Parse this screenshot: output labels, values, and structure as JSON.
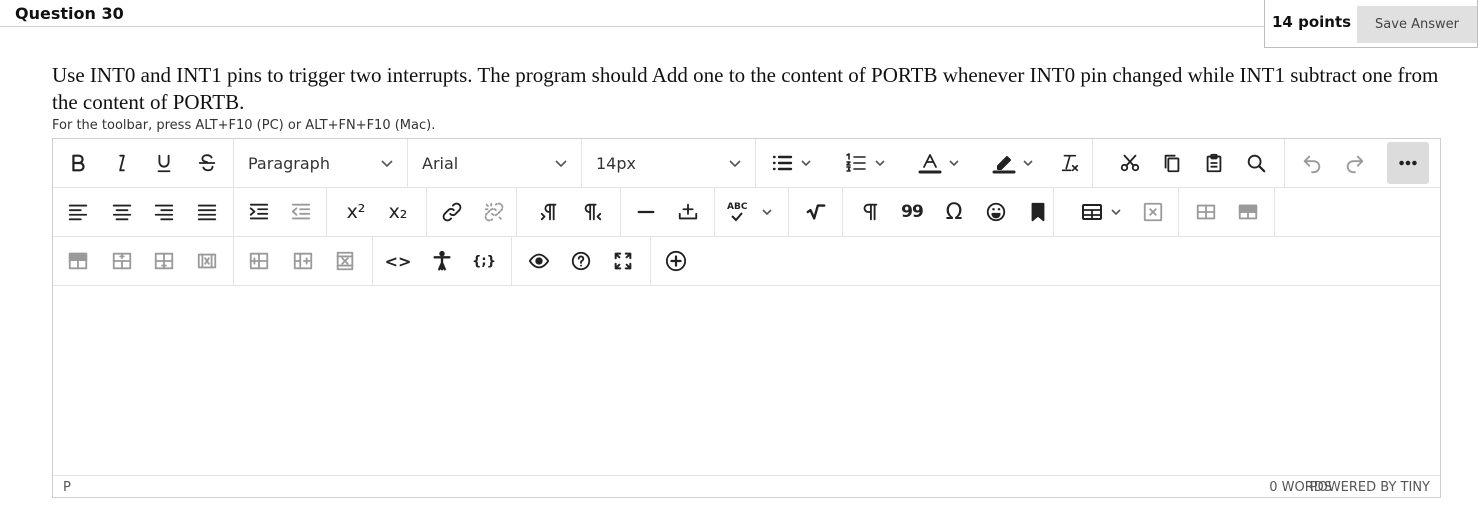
{
  "question": {
    "title": "Question 30",
    "points": "14 points",
    "save_label": "Save Answer",
    "prompt": "Use INT0 and INT1 pins to trigger two interrupts. The program should Add one to the content of PORTB whenever INT0 pin changed while INT1 subtract one from the content of PORTB."
  },
  "editor": {
    "hint": "For the toolbar, press ALT+F10 (PC) or ALT+FN+F10 (Mac).",
    "block_format": "Paragraph",
    "font_family": "Arial",
    "font_size": "14px",
    "superscript_label": "x²",
    "subscript_label": "x₂",
    "spellcheck_label": "ABC",
    "quote_label": "99",
    "special_char_label": "Ω",
    "code_label": "<>",
    "placeholder_label": "{;}",
    "status_path": "P",
    "word_count": "0 WORDS",
    "powered_by": "POWERED BY TINY"
  },
  "colors": {
    "border": "#cfcfcf",
    "save_button_bg": "#e0e0e0",
    "more_button_bg": "#dcdcdc"
  }
}
